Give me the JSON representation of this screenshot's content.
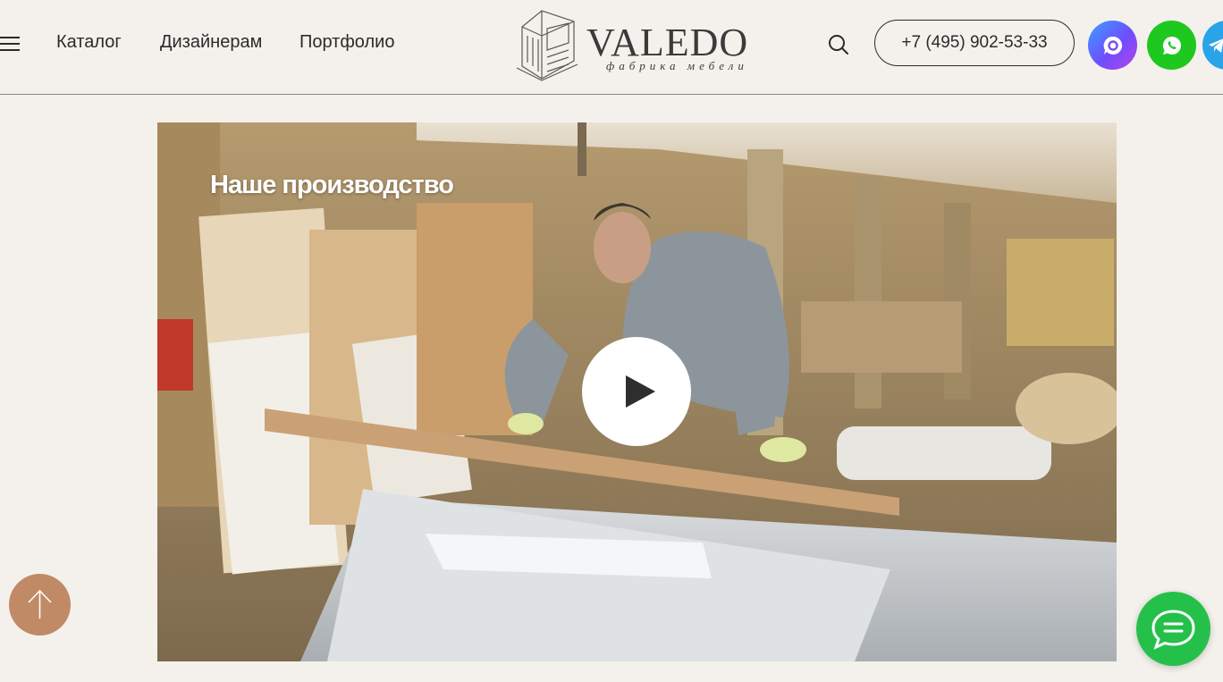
{
  "header": {
    "menu_icon": "hamburger-menu-icon",
    "nav": [
      {
        "label": "Каталог"
      },
      {
        "label": "Дизайнерам"
      },
      {
        "label": "Портфолио"
      }
    ],
    "logo": {
      "name": "VALEDO",
      "tagline": "фабрика мебели"
    },
    "search_icon": "search-icon",
    "phone": "+7 (495) 902-53-33",
    "socials": [
      {
        "name": "max-messenger",
        "icon": "max-icon",
        "color": "#6f4dff"
      },
      {
        "name": "whatsapp",
        "icon": "whatsapp-icon",
        "color": "#1ec81e"
      },
      {
        "name": "telegram",
        "icon": "telegram-icon",
        "color": "#2aa4e8"
      }
    ]
  },
  "main": {
    "video": {
      "title": "Наше производство",
      "play_icon": "play-icon"
    }
  },
  "floating": {
    "scroll_top_icon": "arrow-up-icon",
    "scroll_top_color": "#c08a66",
    "chat_icon": "chat-bubble-icon",
    "chat_color": "#25c04a"
  }
}
